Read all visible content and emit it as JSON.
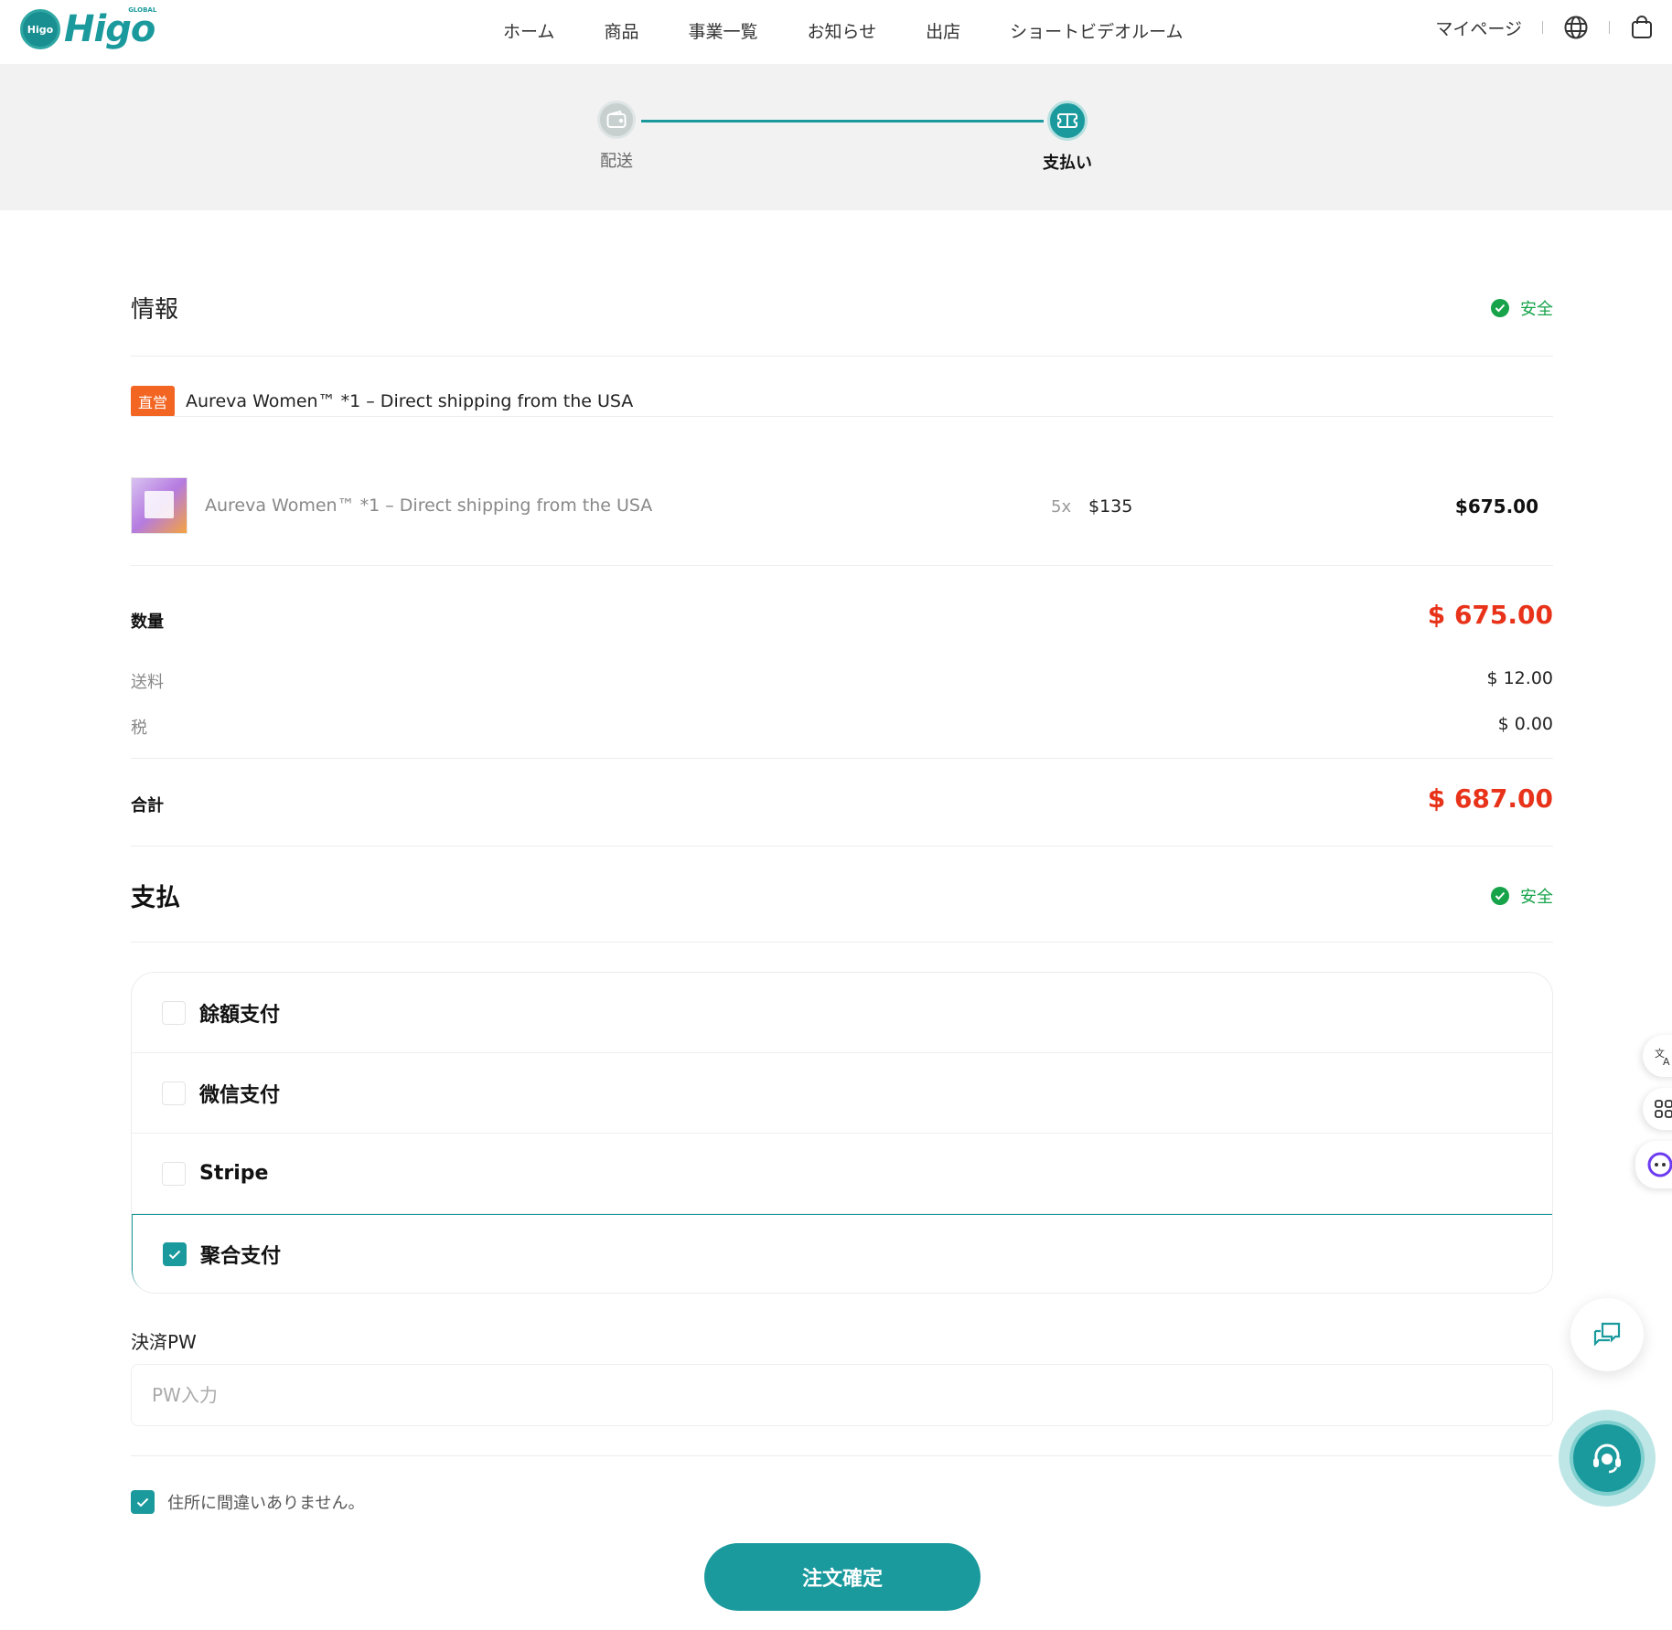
{
  "header": {
    "logo_badge": "Higo",
    "logo_text": "Higo",
    "logo_global": "GLOBAL",
    "nav": [
      "ホーム",
      "商品",
      "事業一覧",
      "お知らせ",
      "出店",
      "ショートビデオルーム"
    ],
    "mypage": "マイページ",
    "icons": [
      "globe-icon",
      "shopping-bag-icon"
    ]
  },
  "progress": {
    "steps": [
      {
        "label": "配送",
        "icon": "wallet-icon",
        "state": "done"
      },
      {
        "label": "支払い",
        "icon": "ticket-icon",
        "state": "current"
      }
    ]
  },
  "info": {
    "title": "情報",
    "safe_label": "安全",
    "seller_badge": "直営",
    "seller_name": "Aureva Women™ *1 – Direct shipping from the USA",
    "item": {
      "name": "Aureva Women™ *1 – Direct shipping from the USA",
      "qty": "5x",
      "price": "$135",
      "total": "$675.00"
    }
  },
  "summary": {
    "subtotal_label": "数量",
    "subtotal_value": "$ 675.00",
    "shipping_label": "送料",
    "shipping_value": "$ 12.00",
    "tax_label": "税",
    "tax_value": "$ 0.00",
    "total_label": "合計",
    "total_value": "$ 687.00"
  },
  "payment": {
    "title": "支払",
    "safe_label": "安全",
    "options": [
      {
        "label": "餘額支付",
        "checked": false
      },
      {
        "label": "微信支付",
        "checked": false
      },
      {
        "label": "Stripe",
        "checked": false
      },
      {
        "label": "聚合支付",
        "checked": true
      }
    ],
    "pw_label": "決済PW",
    "pw_placeholder": "PW入力",
    "address_confirm": "住所に間違いありません。",
    "submit_label": "注文確定"
  },
  "colors": {
    "accent": "#1b9a9d",
    "price_red": "#e8331a",
    "safe_green": "#16a34a",
    "badge_orange": "#f26522"
  }
}
